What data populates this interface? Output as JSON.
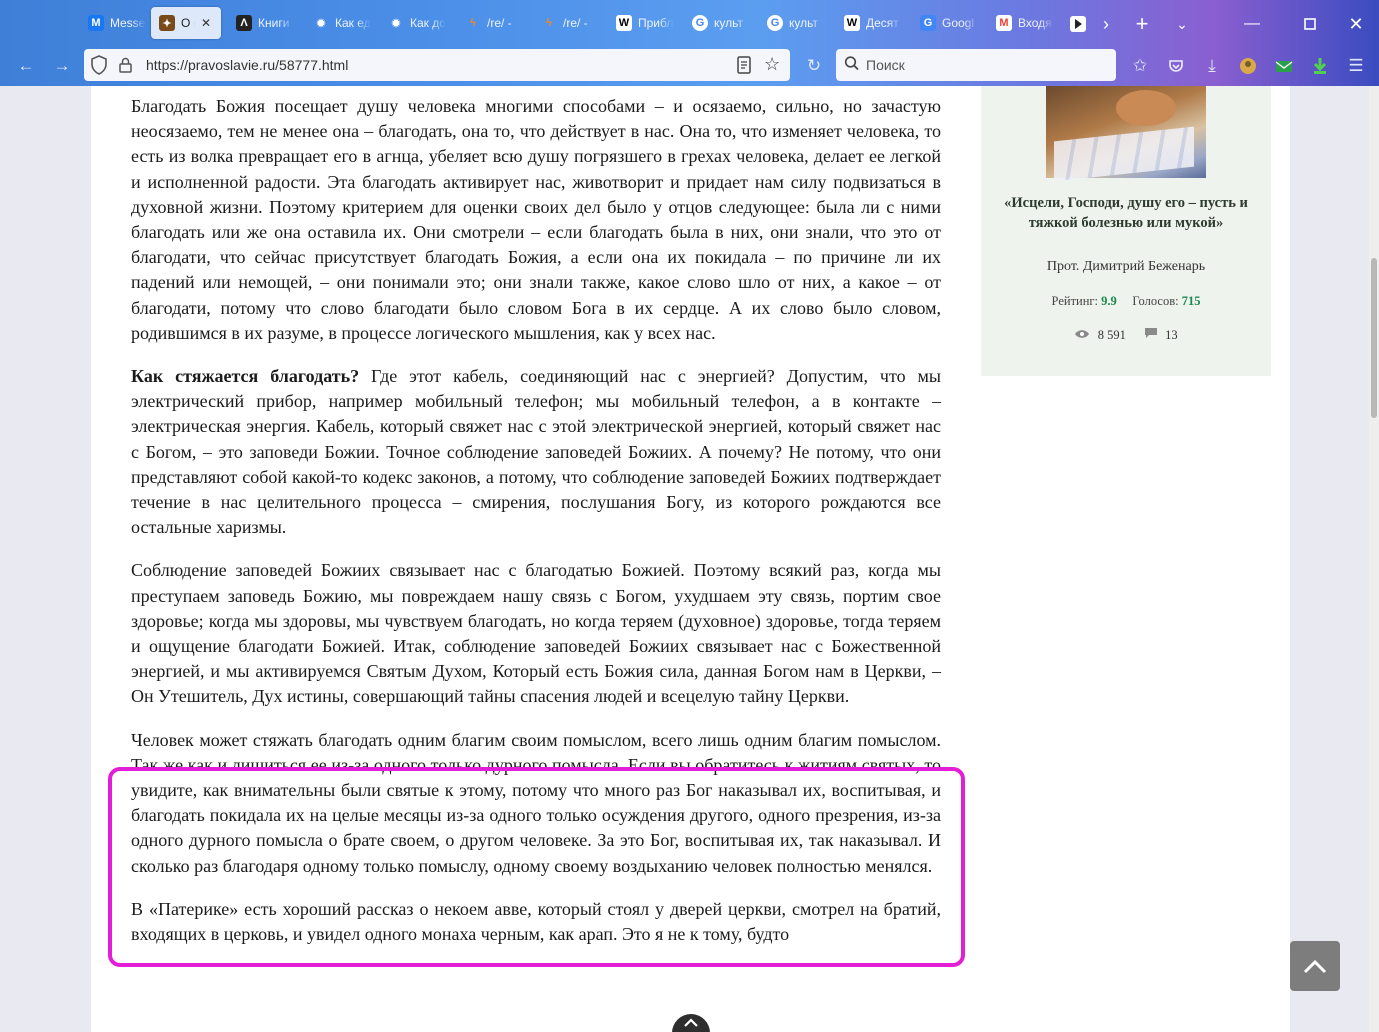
{
  "browser": {
    "tabs": [
      {
        "title": "Messenger",
        "favicon": "M",
        "color": "#1877f2"
      },
      {
        "title": "О стяжании благодати",
        "favicon": "✦",
        "color": "#7a4b1a",
        "active": true
      },
      {
        "title": "Книги",
        "favicon": "Λ",
        "color": "#222222"
      },
      {
        "title": "Как единство",
        "favicon": "✹",
        "color": "#e8eef8"
      },
      {
        "title": "Как достичь",
        "favicon": "✹",
        "color": "#e8eef8"
      },
      {
        "title": "/re/ -",
        "favicon": "ϟ",
        "color": "#f08a1c"
      },
      {
        "title": "/re/ -",
        "favicon": "ϟ",
        "color": "#f08a1c"
      },
      {
        "title": "Прибл",
        "favicon": "W",
        "color": "#ffffff"
      },
      {
        "title": "культ",
        "favicon": "G",
        "color": "#ffffff"
      },
      {
        "title": "культ",
        "favicon": "G",
        "color": "#ffffff"
      },
      {
        "title": "Десят",
        "favicon": "W",
        "color": "#ffffff"
      },
      {
        "title": "Googl",
        "favicon": "G",
        "color": "#4285f4"
      },
      {
        "title": "Входя",
        "favicon": "M",
        "color": "#ea4335"
      }
    ],
    "url": "https://pravoslavie.ru/58777.html",
    "search_placeholder": "Поиск"
  },
  "article": {
    "p1": "Благодать Божия посещает душу человека многими способами – и осязаемо, сильно, но зачастую неосязаемо, тем не менее она – благодать, она то, что действует в нас. Она то, что изменяет человека, то есть из волка превращает его в агнца, убеляет всю душу погрязшего в грехах человека, делает ее легкой и исполненной радости. Эта благодать активирует нас, животворит и придает нам силу подвизаться в духовной жизни. Поэтому критерием для оценки своих дел было у отцов следующее: была ли с ними благодать или же она оставила их. Они смотрели – если благодать была в них, они знали, что это от благодати, что сейчас присутствует благодать Божия, а если она их покидала – по причине ли их падений или немощей, – они понимали это; они знали также, какое слово шло от них, а какое – от благодати, потому что слово благодати было словом Бога в их сердце. А их слово было словом, родившимся в их разуме, в процессе логического мышления, как у всех нас.",
    "p2_bold": "Как стяжается благодать?",
    "p2": " Где этот кабель, соединяющий нас с энергией? Допустим, что мы электрический прибор, например мобильный телефон; мы мобильный телефон, а в контакте – электрическая энергия. Кабель, который свяжет нас с этой электрической энергией, который свяжет нас с Богом, – это заповеди Божии. Точное соблюдение заповедей Божиих. А почему? Не потому, что они представляют собой какой-то кодекс законов, а потому, что соблюдение заповедей Божиих подтверждает течение в нас целительного процесса – смирения, послушания Богу, из которого рождаются все остальные харизмы.",
    "p3": "Соблюдение заповедей Божиих связывает нас с благодатью Божией. Поэтому всякий раз, когда мы преступаем заповедь Божию, мы повреждаем нашу связь с Богом, ухудшаем эту связь, портим свое здоровье; когда мы здоровы, мы чувствуем благодать, но когда теряем (духовное) здоровье, тогда теряем и ощущение благодати Божией. Итак, соблюдение заповедей Божиих связывает нас с Божественной энергией, и мы активируемся Святым Духом, Который есть Божия сила, данная Богом нам в Церкви, – Он Утешитель, Дух истины, совершающий тайны спасения людей и всецелую тайну Церкви.",
    "p4": "Человек может стяжать благодать одним благим своим помыслом, всего лишь одним благим помыслом. Так же как и лишиться ее из-за одного только дурного помысла. Если вы обратитесь к житиям святых, то увидите, как внимательны были святые к этому, потому что много раз Бог наказывал их, воспитывая, и благодать покидала их на целые месяцы из-за одного только осуждения другого, одного презрения, из-за одного дурного помысла о брате своем, о другом человеке. За это Бог, воспитывая их, так наказывал. И сколько раз благодаря одному только помыслу, одному своему воздыханию человек полностью менялся.",
    "p5": "В «Патерике» есть хороший рассказ о некоем авве, который стоял у дверей церкви, смотрел на братий, входящих в церковь, и увидел одного монаха черным, как арап. Это я не к тому, будто"
  },
  "sidebar": {
    "title": "«Исцели, Господи, душу его – пусть и тяжкой болезнью или мукой»",
    "author": "Прот. Димитрий Беженарь",
    "rating_label": "Рейтинг:",
    "rating_value": "9.9",
    "votes_label": "Голосов:",
    "votes_value": "715",
    "views": "8 591",
    "comments": "13"
  },
  "colors": {
    "highlight": "#e21fd6",
    "sidebar_bg": "#eef3ee",
    "rating": "#1a8a4a"
  }
}
